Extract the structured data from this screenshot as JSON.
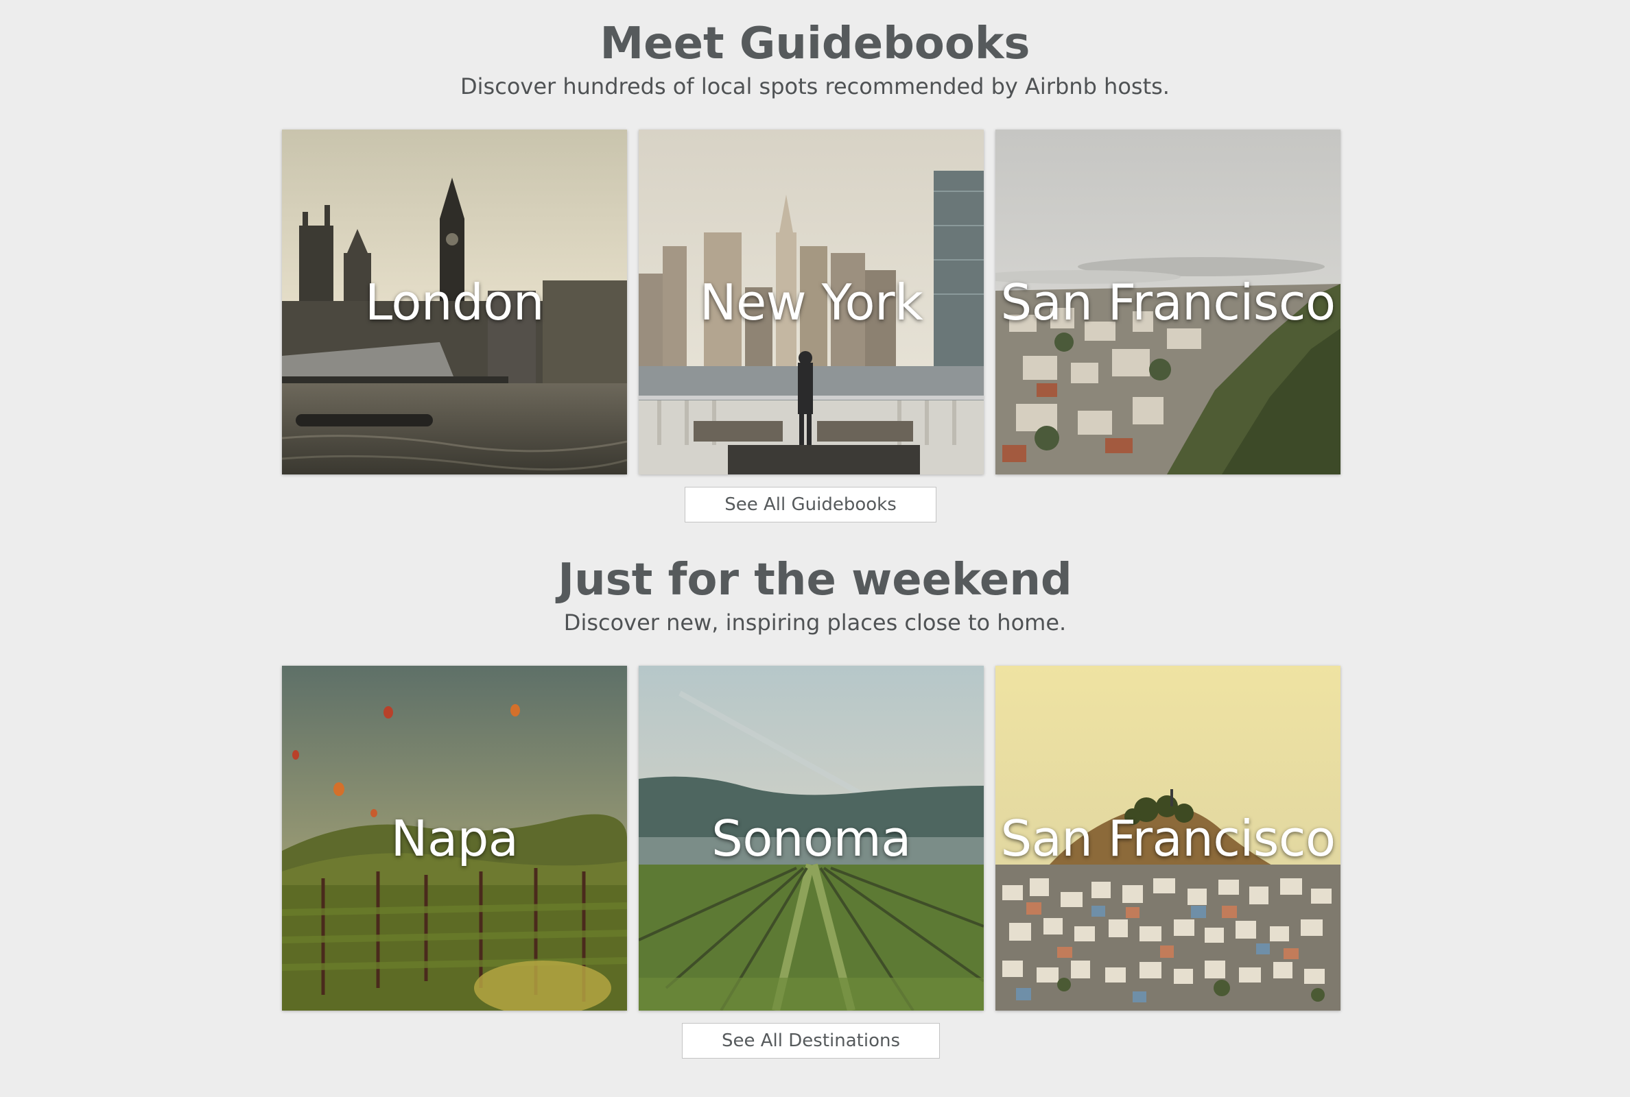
{
  "guidebooks": {
    "title": "Meet Guidebooks",
    "subtitle": "Discover hundreds of local spots recommended by Airbnb hosts.",
    "cards": [
      {
        "label": "London",
        "scene": "london-skyline-image"
      },
      {
        "label": "New York",
        "scene": "new-york-skyline-image"
      },
      {
        "label": "San Francisco",
        "scene": "san-francisco-hillside-image"
      }
    ],
    "button_label": "See All Guidebooks"
  },
  "weekend": {
    "title": "Just for the weekend",
    "subtitle": "Discover new, inspiring places close to home.",
    "cards": [
      {
        "label": "Napa",
        "scene": "napa-vineyard-balloons-image"
      },
      {
        "label": "Sonoma",
        "scene": "sonoma-vineyard-rows-image"
      },
      {
        "label": "San Francisco",
        "scene": "san-francisco-houses-image"
      }
    ],
    "button_label": "See All Destinations"
  },
  "colors": {
    "background": "#ededed",
    "heading": "#565a5c",
    "button_bg": "#ffffff",
    "card_text": "#ffffff"
  }
}
